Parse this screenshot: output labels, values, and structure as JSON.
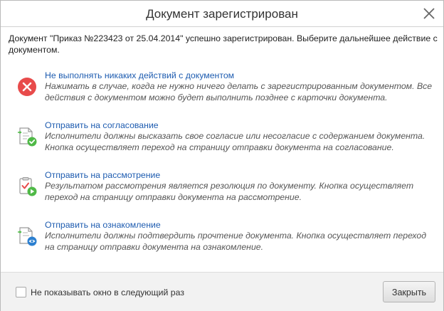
{
  "dialog": {
    "title": "Документ зарегистрирован",
    "intro": "Документ \"Приказ №223423 от 25.04.2014\" успешно зарегистрирован. Выберите дальнейшее действие с документом.",
    "options": [
      {
        "link": "Не выполнять никаких действий с документом",
        "desc": "Нажимать в случае, когда не нужно ничего делать с зарегистрированным документом. Все действия с документом можно будет выполнить позднее с карточки документа.",
        "icon": "cancel-icon"
      },
      {
        "link": "Отправить на согласование",
        "desc": "Исполнители должны высказать свое согласие или несогласие с содержанием документа. Кнопка осуществляет переход на страницу отправки документа на согласование.",
        "icon": "document-approve-icon"
      },
      {
        "link": "Отправить на рассмотрение",
        "desc": "Результатом рассмотрения является резолюция по документу. Кнопка осуществляет переход на страницу отправки документа на рассмотрение.",
        "icon": "clipboard-review-icon"
      },
      {
        "link": "Отправить на ознакомление",
        "desc": "Исполнители должны подтвердить прочтение документа. Кнопка осуществляет переход на страницу отправки документа на ознакомление.",
        "icon": "document-view-icon"
      }
    ],
    "footer": {
      "checkbox_label": "Не показывать окно в следующий раз",
      "close_label": "Закрыть"
    }
  },
  "colors": {
    "link": "#1e5cb0",
    "cancel_red": "#e84b4b",
    "success_green": "#4fb947",
    "view_blue": "#2b7fd0"
  }
}
